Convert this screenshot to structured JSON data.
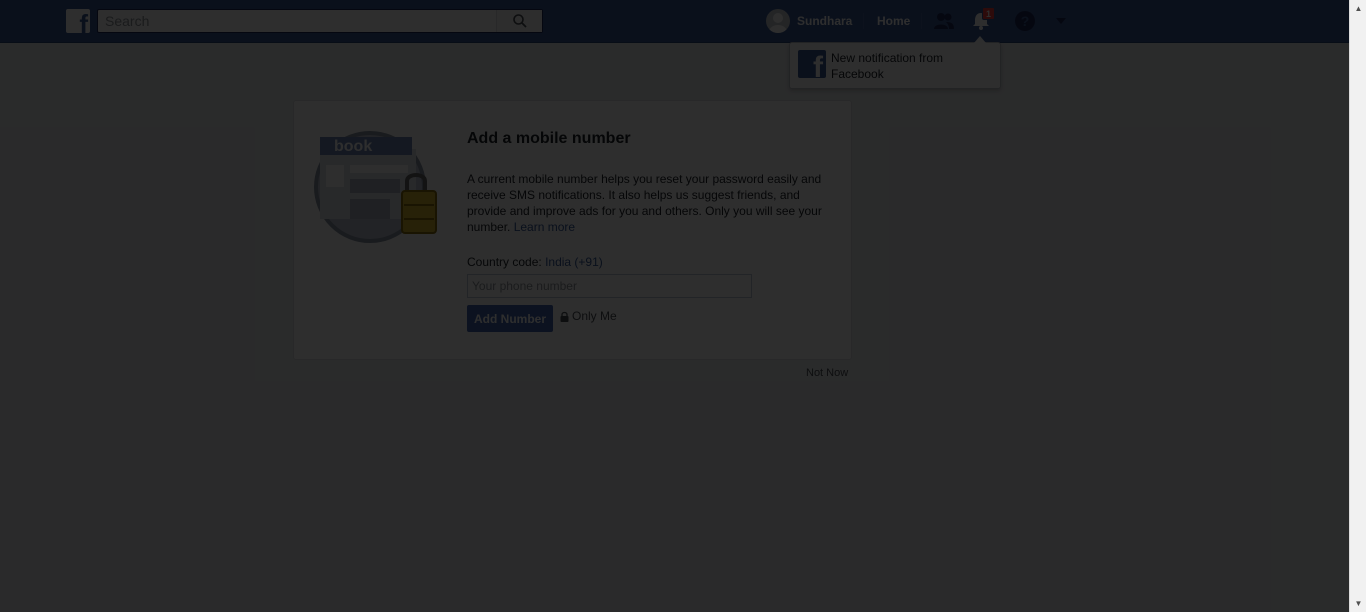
{
  "topbar": {
    "logo_icon": "facebook-f-icon",
    "logo_glyph": "f",
    "search_placeholder": "Search",
    "user_name": "Sundhara",
    "home_label": "Home",
    "notification_count": "1",
    "icons": [
      "friends-icon",
      "notifications-bell-icon",
      "help-icon",
      "chevron-down-icon"
    ]
  },
  "notification_popup": {
    "logo_glyph": "f",
    "text": "New notification from Facebook"
  },
  "card": {
    "title": "Add a mobile number",
    "description": "A current mobile number helps you reset your password easily and receive SMS notifications. It also helps us suggest friends, and provide and improve ads for you and others. Only you will see your number.",
    "learn_more": "Learn more",
    "country_label": "Country code:",
    "country_value": "India (+91)",
    "phone_placeholder": "Your phone number",
    "add_button": "Add Number",
    "privacy_label": "Only Me",
    "illustration_text": "book"
  },
  "not_now": "Not Now",
  "colors": {
    "brand": "#3b5998",
    "button": "#4267b2",
    "background": "#e9ebee",
    "overlay": "rgba(0,0,0,0.82)"
  }
}
